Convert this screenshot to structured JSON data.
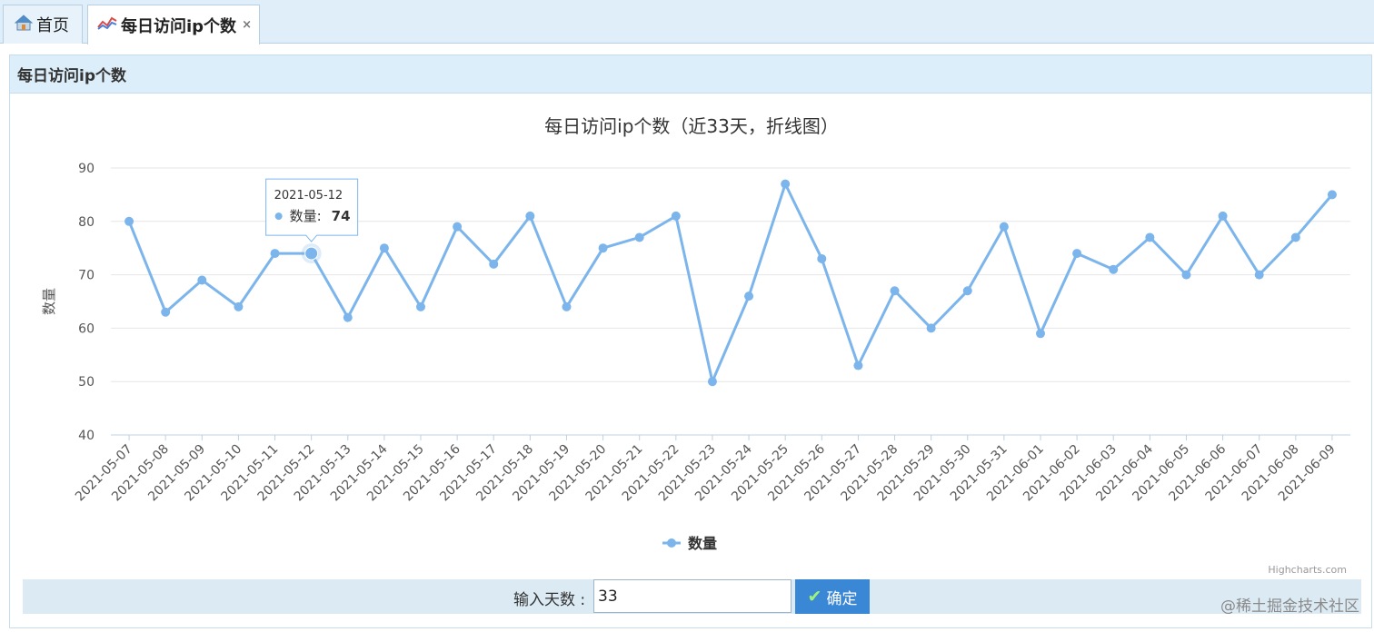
{
  "tabs": {
    "home_label": "首页",
    "active_label": "每日访问ip个数",
    "close_glyph": "×"
  },
  "panel": {
    "title": "每日访问ip个数"
  },
  "chart_data": {
    "type": "line",
    "title": "每日访问ip个数（近33天，折线图）",
    "ylabel": "数量",
    "ylim": [
      40,
      90
    ],
    "yticks": [
      40,
      50,
      60,
      70,
      80,
      90
    ],
    "grid": true,
    "legend_position": "bottom-center",
    "credits": "Highcharts.com",
    "color": "#7cb5ec",
    "categories": [
      "2021-05-07",
      "2021-05-08",
      "2021-05-09",
      "2021-05-10",
      "2021-05-11",
      "2021-05-12",
      "2021-05-13",
      "2021-05-14",
      "2021-05-15",
      "2021-05-16",
      "2021-05-17",
      "2021-05-18",
      "2021-05-19",
      "2021-05-20",
      "2021-05-21",
      "2021-05-22",
      "2021-05-23",
      "2021-05-24",
      "2021-05-25",
      "2021-05-26",
      "2021-05-27",
      "2021-05-28",
      "2021-05-29",
      "2021-05-30",
      "2021-05-31",
      "2021-06-01",
      "2021-06-02",
      "2021-06-03",
      "2021-06-04",
      "2021-06-05",
      "2021-06-06",
      "2021-06-07",
      "2021-06-08",
      "2021-06-09"
    ],
    "series": [
      {
        "name": "数量",
        "values": [
          80,
          63,
          69,
          64,
          74,
          74,
          62,
          75,
          64,
          79,
          72,
          81,
          64,
          75,
          77,
          81,
          50,
          66,
          87,
          73,
          53,
          67,
          60,
          67,
          79,
          59,
          74,
          71,
          77,
          70,
          81,
          70,
          77,
          85
        ]
      }
    ],
    "tooltip": {
      "date": "2021-05-12",
      "series": "数量",
      "value": "74"
    }
  },
  "controls": {
    "days_label": "输入天数 :",
    "days_value": "33",
    "confirm_label": "确定"
  },
  "watermark": "@稀土掘金技术社区"
}
